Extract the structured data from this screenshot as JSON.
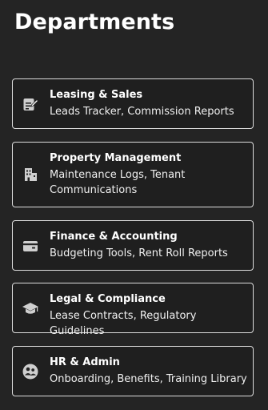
{
  "page": {
    "title": "Departments"
  },
  "departments": [
    {
      "name": "Leasing & Sales",
      "description": "Leads Tracker, Commission Reports",
      "icon": "edit-document-icon"
    },
    {
      "name": "Property Management",
      "description": "Maintenance Logs, Tenant Communications",
      "icon": "building-icon"
    },
    {
      "name": "Finance & Accounting",
      "description": "Budgeting Tools, Rent Roll Reports",
      "icon": "wallet-icon"
    },
    {
      "name": "Legal & Compliance",
      "description": "Lease Contracts, Regulatory Guidelines",
      "icon": "graduation-cap-icon"
    },
    {
      "name": "HR & Admin",
      "description": "Onboarding, Benefits, Training Library",
      "icon": "people-group-icon"
    }
  ],
  "colors": {
    "background": "#242424",
    "card_border": "#dcdcdc",
    "text": "#ffffff"
  }
}
